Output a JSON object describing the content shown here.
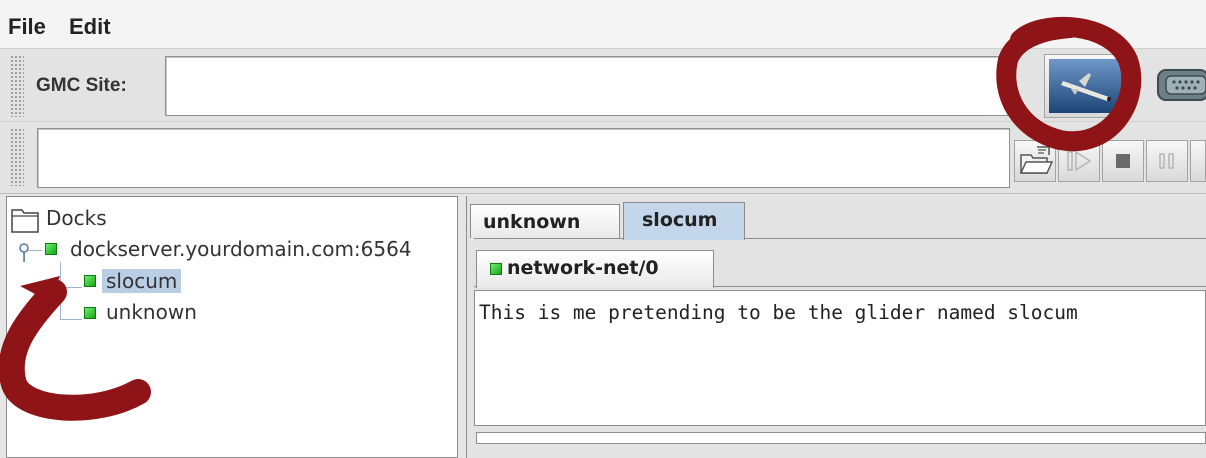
{
  "menu": {
    "file": "File",
    "edit": "Edit"
  },
  "toolbar": {
    "site_label": "GMC Site:",
    "site_value": "",
    "command_value": ""
  },
  "tree": {
    "root": "Docks",
    "server": "dockserver.yourdomain.com:6564",
    "children": [
      "slocum",
      "unknown"
    ],
    "selected": "slocum"
  },
  "tabs": {
    "outer": [
      "unknown",
      "slocum"
    ],
    "outer_selected": "slocum",
    "inner": "network-net/0"
  },
  "output": {
    "text": "This is me pretending to be the glider named slocum"
  },
  "colors": {
    "annotation": "#8e1417",
    "selection": "#b9cde5",
    "active_tab": "#c3d6ea",
    "node_green": "#22b022"
  },
  "icons": [
    "glider-icon",
    "serial-port-icon",
    "open-folder-icon",
    "play-icon",
    "stop-icon",
    "pause-icon",
    "folder-icon",
    "tree-handle-icon"
  ]
}
